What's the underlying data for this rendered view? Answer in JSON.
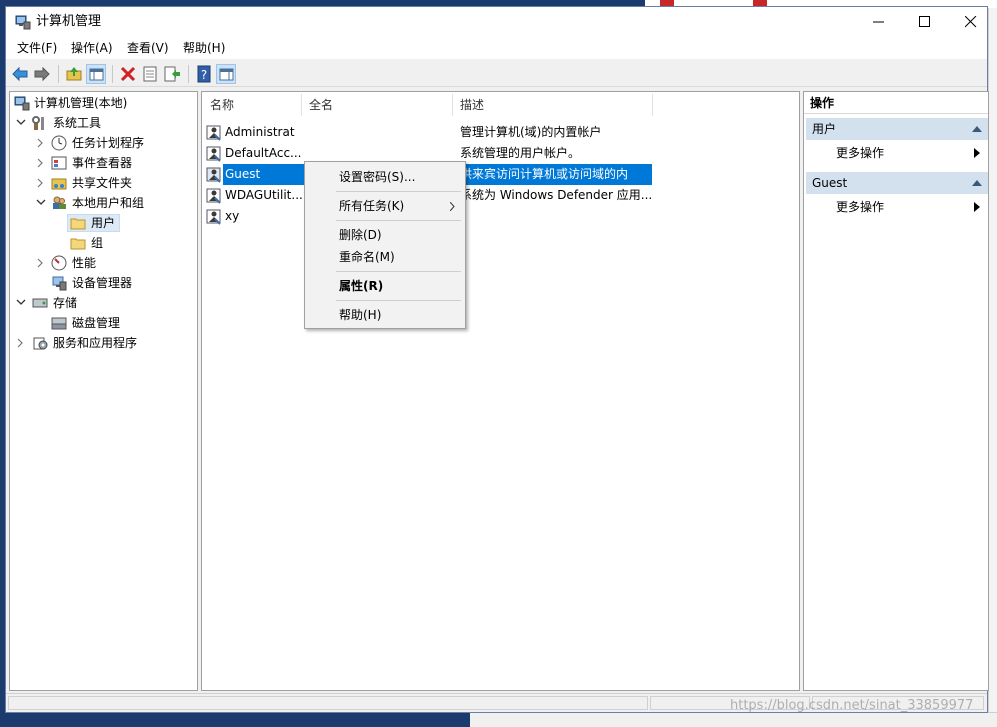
{
  "window": {
    "title": "计算机管理"
  },
  "menubar": [
    "文件(F)",
    "操作(A)",
    "查看(V)",
    "帮助(H)"
  ],
  "toolbar": {
    "icons": [
      "back-arrow-icon",
      "forward-arrow-icon",
      "up-folder-icon",
      "show-hide-tree-icon",
      "delete-icon",
      "properties-icon",
      "export-list-icon",
      "help-icon",
      "show-hide-action-pane-icon"
    ]
  },
  "tree": {
    "root": "计算机管理(本地)",
    "system_tools": "系统工具",
    "task_scheduler": "任务计划程序",
    "event_viewer": "事件查看器",
    "shared_folders": "共享文件夹",
    "local_users_groups": "本地用户和组",
    "users": "用户",
    "groups": "组",
    "performance": "性能",
    "device_manager": "设备管理器",
    "storage": "存储",
    "disk_management": "磁盘管理",
    "services_apps": "服务和应用程序"
  },
  "list": {
    "columns": [
      "名称",
      "全名",
      "描述"
    ],
    "rows": [
      {
        "name": "Administrat",
        "full_name": "",
        "description": "管理计算机(域)的内置帐户"
      },
      {
        "name": "DefaultAcc...",
        "full_name": "",
        "description": "系统管理的用户帐户。"
      },
      {
        "name": "Guest",
        "full_name": "",
        "description": "供来宾访问计算机或访问域的内"
      },
      {
        "name": "WDAGUtilit...",
        "full_name": "",
        "description": "系统为 Windows Defender 应用..."
      },
      {
        "name": "xy",
        "full_name": "",
        "description": ""
      }
    ]
  },
  "actions": {
    "header": "操作",
    "group1": "用户",
    "group1_more": "更多操作",
    "group2": "Guest",
    "group2_more": "更多操作"
  },
  "context_menu": {
    "set_password": "设置密码(S)...",
    "all_tasks": "所有任务(K)",
    "delete": "删除(D)",
    "rename": "重命名(M)",
    "properties": "属性(R)",
    "help": "帮助(H)"
  },
  "watermark": "https://blog.csdn.net/sinat_33859977"
}
